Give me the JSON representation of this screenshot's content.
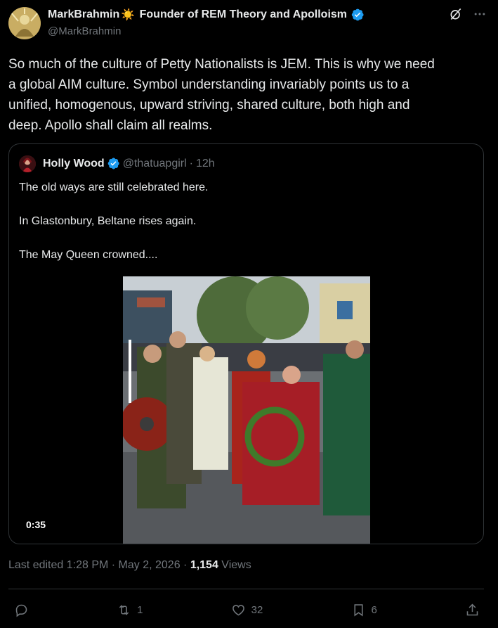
{
  "author": {
    "display_name": "MarkBrahmin",
    "sun_emoji": "☀️",
    "title_suffix": " Founder of REM Theory and Apolloism",
    "handle": "@MarkBrahmin"
  },
  "post": {
    "lines": [
      "So much of the culture of Petty Nationalists is JEM. This is why we need",
      "a global AIM culture. Symbol understanding invariably points us to a",
      "unified, homogenous, upward striving, shared culture, both high and",
      "deep. Apollo shall claim all realms."
    ]
  },
  "quote": {
    "name": "Holly Wood",
    "handle": "@thatuapgirl",
    "separator": "·",
    "time": "12h",
    "paragraphs": [
      "The old ways are still celebrated here.",
      "In Glastonbury, Beltane rises again.",
      "The May Queen crowned...."
    ],
    "video_duration": "0:35"
  },
  "meta": {
    "edited": "Last edited 1:28 PM · May 2, 2026 · ",
    "views_count": "1,154",
    "views_label": " Views"
  },
  "actions": {
    "reposts": "1",
    "likes": "32",
    "bookmarks": "6"
  },
  "colors": {
    "background": "#000000",
    "text": "#e7e9ea",
    "muted": "#71767b",
    "verified": "#1d9bf0",
    "border": "#2f3336"
  }
}
